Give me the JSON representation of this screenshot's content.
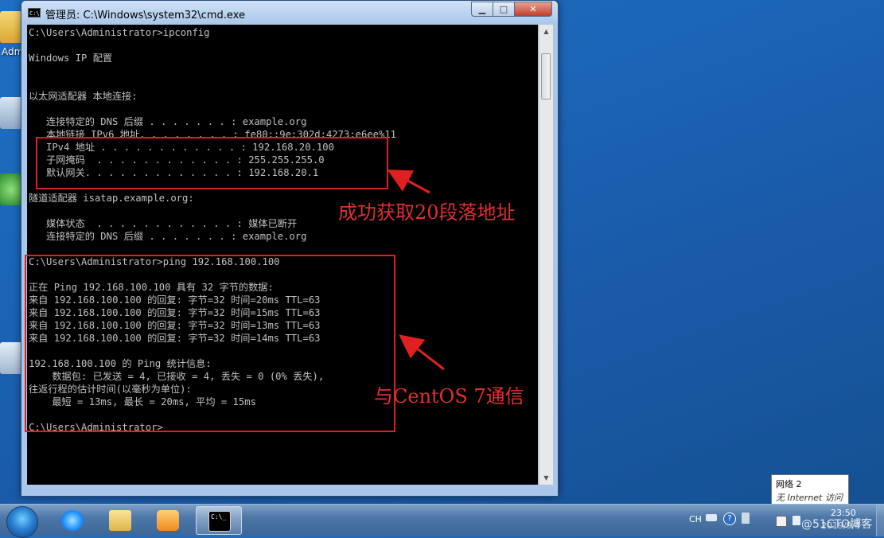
{
  "window": {
    "title": "管理员: C:\\Windows\\system32\\cmd.exe",
    "icon_text": "C:\\.",
    "minimize_glyph": "▁",
    "maximize_glyph": "□",
    "close_glyph": "✕"
  },
  "console_lines": [
    "C:\\Users\\Administrator>ipconfig",
    "",
    "Windows IP 配置",
    "",
    "",
    "以太网适配器 本地连接:",
    "",
    "   连接特定的 DNS 后缀 . . . . . . . : example.org",
    "   本地链接 IPv6 地址. . . . . . . . : fe80::9e:302d:4273:e6ee%11",
    "   IPv4 地址 . . . . . . . . . . . . : 192.168.20.100",
    "   子网掩码  . . . . . . . . . . . . : 255.255.255.0",
    "   默认网关. . . . . . . . . . . . . : 192.168.20.1",
    "",
    "隧道适配器 isatap.example.org:",
    "",
    "   媒体状态  . . . . . . . . . . . . : 媒体已断开",
    "   连接特定的 DNS 后缀 . . . . . . . : example.org",
    "",
    "C:\\Users\\Administrator>ping 192.168.100.100",
    "",
    "正在 Ping 192.168.100.100 具有 32 字节的数据:",
    "来自 192.168.100.100 的回复: 字节=32 时间=20ms TTL=63",
    "来自 192.168.100.100 的回复: 字节=32 时间=15ms TTL=63",
    "来自 192.168.100.100 的回复: 字节=32 时间=13ms TTL=63",
    "来自 192.168.100.100 的回复: 字节=32 时间=14ms TTL=63",
    "",
    "192.168.100.100 的 Ping 统计信息:",
    "    数据包: 已发送 = 4, 已接收 = 4, 丢失 = 0 (0% 丢失),",
    "往返行程的估计时间(以毫秒为单位):",
    "    最短 = 13ms, 最长 = 20ms, 平均 = 15ms",
    "",
    "C:\\Users\\Administrator>"
  ],
  "annotations": {
    "ip_note": "成功获取20段落地址",
    "ping_note": "与CentOS 7通信"
  },
  "desktop": {
    "icon_label": "Adm"
  },
  "tooltip": {
    "line1": "网络 2",
    "line2": "无 Internet 访问"
  },
  "taskbar": {
    "language": "CH",
    "clock_time": "23:50",
    "clock_date": "2019/9/4",
    "watermark": "@51CTO博客",
    "help_glyph": "?"
  },
  "colors": {
    "console_bg": "#000000",
    "console_text": "#c0c0c0",
    "annotation_red": "#e03030",
    "desktop_blue": "#1b64b6"
  }
}
